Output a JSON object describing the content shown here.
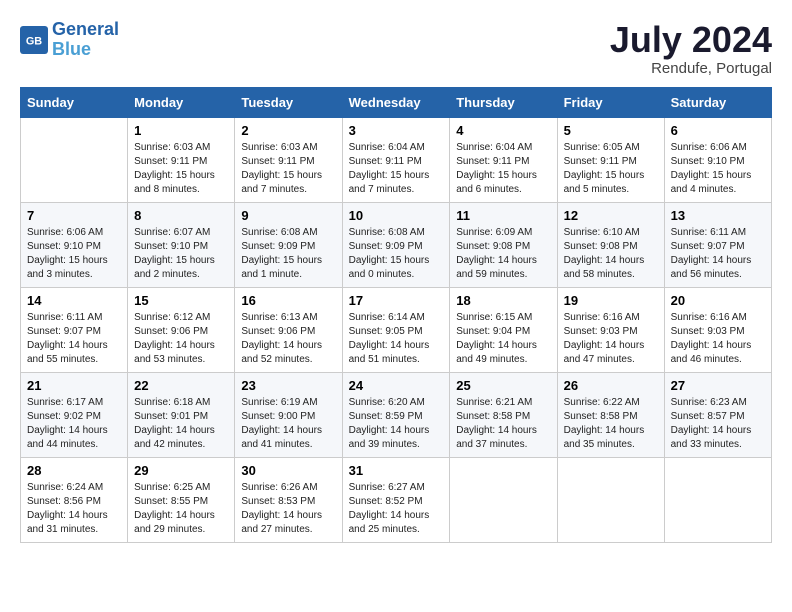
{
  "header": {
    "logo_line1": "General",
    "logo_line2": "Blue",
    "month_year": "July 2024",
    "location": "Rendufe, Portugal"
  },
  "weekdays": [
    "Sunday",
    "Monday",
    "Tuesday",
    "Wednesday",
    "Thursday",
    "Friday",
    "Saturday"
  ],
  "weeks": [
    [
      {
        "day": "",
        "sunrise": "",
        "sunset": "",
        "daylight": ""
      },
      {
        "day": "1",
        "sunrise": "6:03 AM",
        "sunset": "9:11 PM",
        "daylight": "15 hours and 8 minutes."
      },
      {
        "day": "2",
        "sunrise": "6:03 AM",
        "sunset": "9:11 PM",
        "daylight": "15 hours and 7 minutes."
      },
      {
        "day": "3",
        "sunrise": "6:04 AM",
        "sunset": "9:11 PM",
        "daylight": "15 hours and 7 minutes."
      },
      {
        "day": "4",
        "sunrise": "6:04 AM",
        "sunset": "9:11 PM",
        "daylight": "15 hours and 6 minutes."
      },
      {
        "day": "5",
        "sunrise": "6:05 AM",
        "sunset": "9:11 PM",
        "daylight": "15 hours and 5 minutes."
      },
      {
        "day": "6",
        "sunrise": "6:06 AM",
        "sunset": "9:10 PM",
        "daylight": "15 hours and 4 minutes."
      }
    ],
    [
      {
        "day": "7",
        "sunrise": "6:06 AM",
        "sunset": "9:10 PM",
        "daylight": "15 hours and 3 minutes."
      },
      {
        "day": "8",
        "sunrise": "6:07 AM",
        "sunset": "9:10 PM",
        "daylight": "15 hours and 2 minutes."
      },
      {
        "day": "9",
        "sunrise": "6:08 AM",
        "sunset": "9:09 PM",
        "daylight": "15 hours and 1 minute."
      },
      {
        "day": "10",
        "sunrise": "6:08 AM",
        "sunset": "9:09 PM",
        "daylight": "15 hours and 0 minutes."
      },
      {
        "day": "11",
        "sunrise": "6:09 AM",
        "sunset": "9:08 PM",
        "daylight": "14 hours and 59 minutes."
      },
      {
        "day": "12",
        "sunrise": "6:10 AM",
        "sunset": "9:08 PM",
        "daylight": "14 hours and 58 minutes."
      },
      {
        "day": "13",
        "sunrise": "6:11 AM",
        "sunset": "9:07 PM",
        "daylight": "14 hours and 56 minutes."
      }
    ],
    [
      {
        "day": "14",
        "sunrise": "6:11 AM",
        "sunset": "9:07 PM",
        "daylight": "14 hours and 55 minutes."
      },
      {
        "day": "15",
        "sunrise": "6:12 AM",
        "sunset": "9:06 PM",
        "daylight": "14 hours and 53 minutes."
      },
      {
        "day": "16",
        "sunrise": "6:13 AM",
        "sunset": "9:06 PM",
        "daylight": "14 hours and 52 minutes."
      },
      {
        "day": "17",
        "sunrise": "6:14 AM",
        "sunset": "9:05 PM",
        "daylight": "14 hours and 51 minutes."
      },
      {
        "day": "18",
        "sunrise": "6:15 AM",
        "sunset": "9:04 PM",
        "daylight": "14 hours and 49 minutes."
      },
      {
        "day": "19",
        "sunrise": "6:16 AM",
        "sunset": "9:03 PM",
        "daylight": "14 hours and 47 minutes."
      },
      {
        "day": "20",
        "sunrise": "6:16 AM",
        "sunset": "9:03 PM",
        "daylight": "14 hours and 46 minutes."
      }
    ],
    [
      {
        "day": "21",
        "sunrise": "6:17 AM",
        "sunset": "9:02 PM",
        "daylight": "14 hours and 44 minutes."
      },
      {
        "day": "22",
        "sunrise": "6:18 AM",
        "sunset": "9:01 PM",
        "daylight": "14 hours and 42 minutes."
      },
      {
        "day": "23",
        "sunrise": "6:19 AM",
        "sunset": "9:00 PM",
        "daylight": "14 hours and 41 minutes."
      },
      {
        "day": "24",
        "sunrise": "6:20 AM",
        "sunset": "8:59 PM",
        "daylight": "14 hours and 39 minutes."
      },
      {
        "day": "25",
        "sunrise": "6:21 AM",
        "sunset": "8:58 PM",
        "daylight": "14 hours and 37 minutes."
      },
      {
        "day": "26",
        "sunrise": "6:22 AM",
        "sunset": "8:58 PM",
        "daylight": "14 hours and 35 minutes."
      },
      {
        "day": "27",
        "sunrise": "6:23 AM",
        "sunset": "8:57 PM",
        "daylight": "14 hours and 33 minutes."
      }
    ],
    [
      {
        "day": "28",
        "sunrise": "6:24 AM",
        "sunset": "8:56 PM",
        "daylight": "14 hours and 31 minutes."
      },
      {
        "day": "29",
        "sunrise": "6:25 AM",
        "sunset": "8:55 PM",
        "daylight": "14 hours and 29 minutes."
      },
      {
        "day": "30",
        "sunrise": "6:26 AM",
        "sunset": "8:53 PM",
        "daylight": "14 hours and 27 minutes."
      },
      {
        "day": "31",
        "sunrise": "6:27 AM",
        "sunset": "8:52 PM",
        "daylight": "14 hours and 25 minutes."
      },
      {
        "day": "",
        "sunrise": "",
        "sunset": "",
        "daylight": ""
      },
      {
        "day": "",
        "sunrise": "",
        "sunset": "",
        "daylight": ""
      },
      {
        "day": "",
        "sunrise": "",
        "sunset": "",
        "daylight": ""
      }
    ]
  ]
}
